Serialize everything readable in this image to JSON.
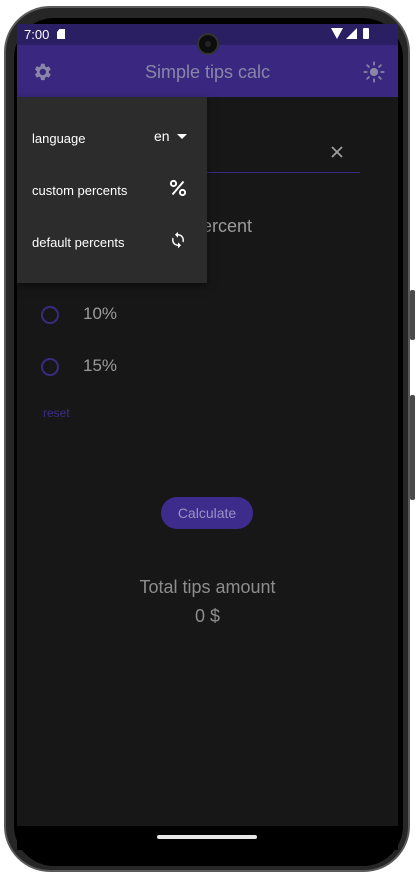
{
  "status_bar": {
    "time": "7:00"
  },
  "app_bar": {
    "title": "Simple tips calc"
  },
  "menu": {
    "items": [
      {
        "label": "language",
        "value": "en"
      },
      {
        "label": "custom percents"
      },
      {
        "label": "default percents"
      }
    ]
  },
  "percent": {
    "section_label_visible": "ercent",
    "options": [
      {
        "label": "10%"
      },
      {
        "label": "15%"
      }
    ],
    "reset_label": "reset"
  },
  "calculate_label": "Calculate",
  "total": {
    "label": "Total tips amount",
    "value": "0 $"
  },
  "icons": {
    "settings": "gear-icon",
    "theme": "sun-icon",
    "clear": "close-icon",
    "custom_percents": "percent-icon",
    "default_percents": "refresh-icon"
  },
  "colors": {
    "app_bar": "#3a2880",
    "status_bar": "#2b1f63",
    "accent": "#3d2c8c",
    "background": "#171717",
    "menu": "#2c2c2c"
  }
}
